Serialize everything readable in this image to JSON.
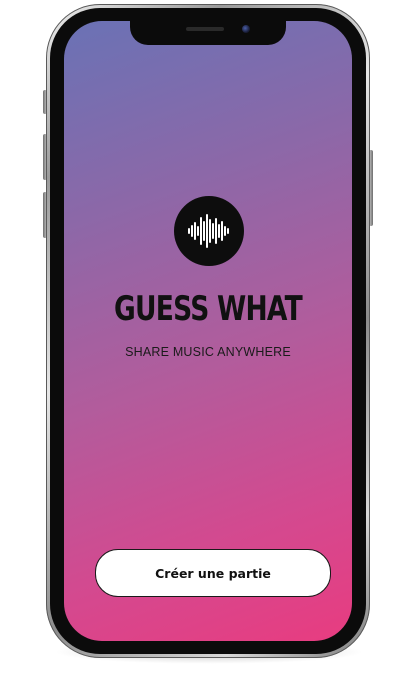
{
  "app": {
    "title": "GUESS WHAT",
    "tagline": "SHARE MUSIC ANYWHERE",
    "logo_icon": "audio-waveform-icon"
  },
  "actions": {
    "create_game_label": "Créer une partie"
  },
  "colors": {
    "gradient_top": "#6a72b5",
    "gradient_bottom": "#e83c80",
    "logo_background": "#0d0d0d",
    "button_background": "#ffffff",
    "text": "#111111"
  }
}
